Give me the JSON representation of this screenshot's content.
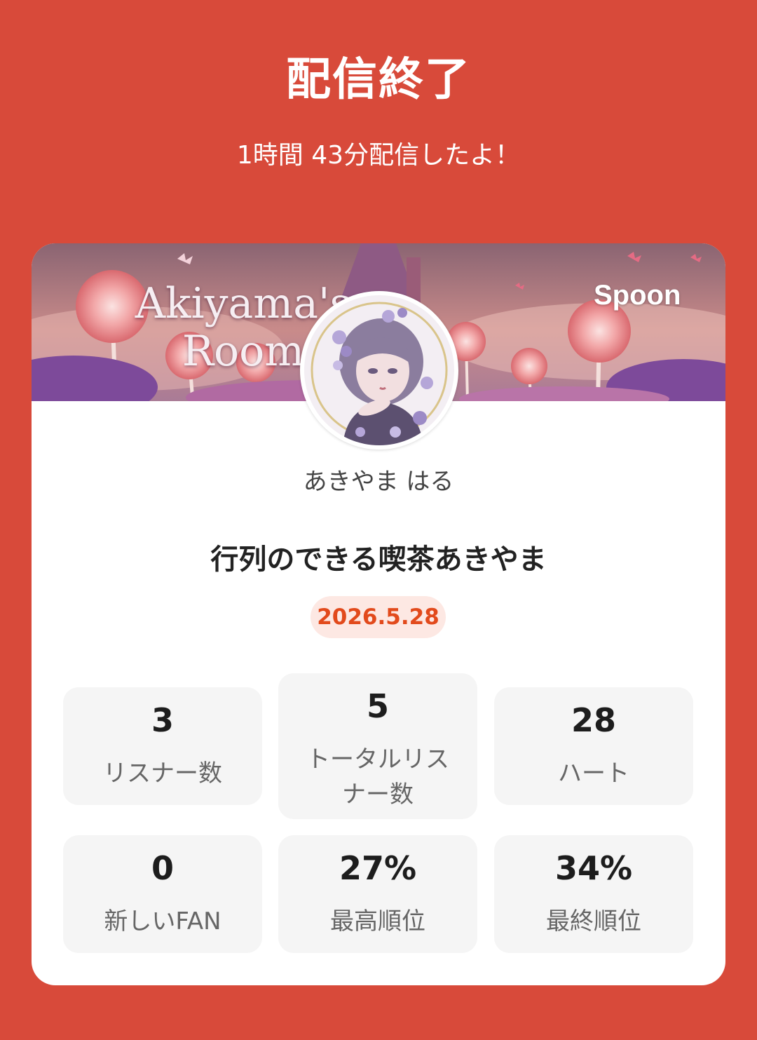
{
  "header": {
    "title": "配信終了",
    "subtitle": "1時間 43分配信したよ！"
  },
  "banner": {
    "title_line1": "Akiyama's",
    "title_line2": "Room",
    "logo": "Spoon"
  },
  "profile": {
    "username": "あきやま はる"
  },
  "stream": {
    "title": "行列のできる喫茶あきやま",
    "date": "2026.5.28"
  },
  "stats": [
    {
      "value": "3",
      "label": "リスナー数"
    },
    {
      "value": "5",
      "label": "トータルリスナー数"
    },
    {
      "value": "28",
      "label": "ハート"
    },
    {
      "value": "0",
      "label": "新しいFAN"
    },
    {
      "value": "27%",
      "label": "最高順位"
    },
    {
      "value": "34%",
      "label": "最終順位"
    }
  ],
  "colors": {
    "background": "#d84a3a",
    "accent": "#e24a1c",
    "badge_bg": "#fde8e3"
  }
}
